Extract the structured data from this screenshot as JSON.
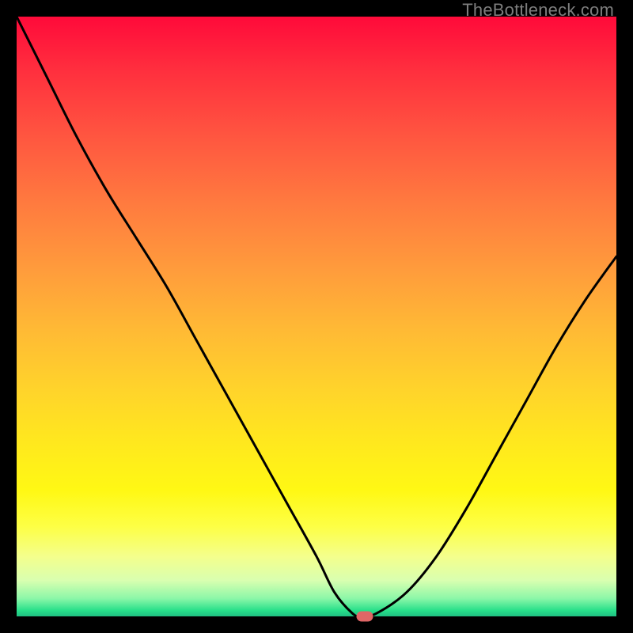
{
  "watermark": "TheBottleneck.com",
  "chart_data": {
    "type": "line",
    "title": "",
    "xlabel": "",
    "ylabel": "",
    "xlim": [
      0,
      100
    ],
    "ylim": [
      0,
      100
    ],
    "x": [
      0,
      5,
      10,
      15,
      20,
      25,
      30,
      35,
      40,
      45,
      50,
      53,
      56,
      57.5,
      60,
      65,
      70,
      75,
      80,
      85,
      90,
      95,
      100
    ],
    "y": [
      100,
      90,
      80,
      71,
      63,
      55,
      46,
      37,
      28,
      19,
      10,
      4,
      0.5,
      0,
      0.5,
      4,
      10,
      18,
      27,
      36,
      45,
      53,
      60
    ],
    "marker": {
      "x": 58,
      "y": 0
    },
    "gradient_stops": [
      {
        "pos": 0,
        "color": "#ff0a3a"
      },
      {
        "pos": 20,
        "color": "#ff5640"
      },
      {
        "pos": 42,
        "color": "#ff9b3c"
      },
      {
        "pos": 62,
        "color": "#ffd32b"
      },
      {
        "pos": 79,
        "color": "#fff814"
      },
      {
        "pos": 94,
        "color": "#d9ffb0"
      },
      {
        "pos": 100,
        "color": "#1fbf82"
      }
    ]
  }
}
